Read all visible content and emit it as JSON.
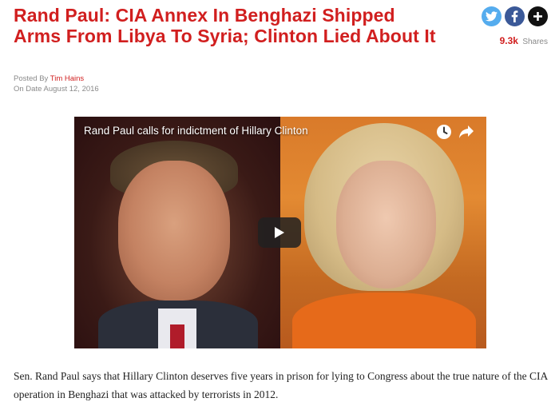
{
  "article": {
    "headline": "Rand Paul: CIA Annex In Benghazi Shipped Arms From Libya To Syria; Clinton Lied About It",
    "byline": {
      "posted_prefix": "Posted By",
      "author": "Tim Hains",
      "date_prefix": "On Date",
      "date": "August 12, 2016"
    },
    "body": "Sen. Rand Paul says that Hillary Clinton deserves five years in prison for lying to Congress about the true nature of the CIA operation in Benghazi that was attacked by terrorists in 2012."
  },
  "share": {
    "count": "9.3k",
    "label": "Shares",
    "buttons": [
      {
        "icon": "twitter-icon",
        "color": "#55acee"
      },
      {
        "icon": "facebook-icon",
        "color": "#3b5998"
      },
      {
        "icon": "plus-icon",
        "color": "#111111"
      }
    ]
  },
  "video": {
    "title": "Rand Paul calls for indictment of Hillary Clinton",
    "controls": [
      "watch-later-icon",
      "share-arrow-icon",
      "play-icon"
    ]
  },
  "colors": {
    "accent": "#d11f1f",
    "meta_text": "#8a8a8a",
    "body_text": "#222222"
  }
}
